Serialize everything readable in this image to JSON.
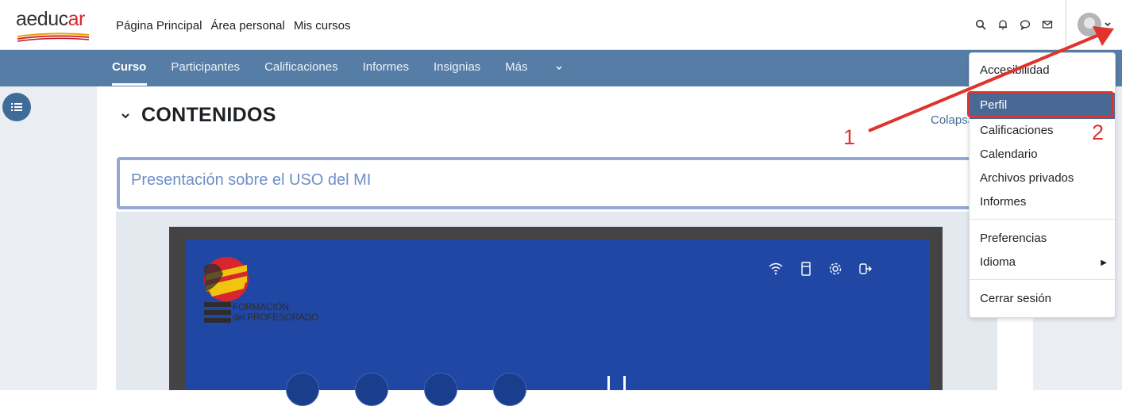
{
  "brand": {
    "logo_text_main": "aeduc",
    "logo_text_accent": "ar"
  },
  "topnav": {
    "items": [
      "Página Principal",
      "Área personal",
      "Mis cursos"
    ]
  },
  "topicons": [
    "search-icon",
    "bell-icon",
    "chat-icon",
    "mail-icon"
  ],
  "secondary_nav": {
    "items": [
      "Curso",
      "Participantes",
      "Calificaciones",
      "Informes",
      "Insignias"
    ],
    "more_label": "Más",
    "active": "Curso"
  },
  "section": {
    "title": "CONTENIDOS",
    "collapse_link": "Colapsar todo"
  },
  "activity": {
    "title": "Presentación sobre el USO del MI"
  },
  "slide": {
    "logo_line1": "FORMACIÓN",
    "logo_line2": "del PROFESORADO",
    "icons": [
      "wifi-icon",
      "usb-icon",
      "settings-icon",
      "exit-icon"
    ]
  },
  "user_menu": {
    "items": [
      "Accesibilidad",
      "Perfil",
      "Calificaciones",
      "Calendario",
      "Archivos privados",
      "Informes",
      "Preferencias",
      "Idioma",
      "Cerrar sesión"
    ],
    "highlighted": "Perfil"
  },
  "annotations": {
    "step1": "1",
    "step2": "2"
  },
  "colors": {
    "nav_blue": "#557da6",
    "menu_active": "#486994",
    "annotation_red": "#e0332b",
    "brand_red": "#d8262f"
  }
}
